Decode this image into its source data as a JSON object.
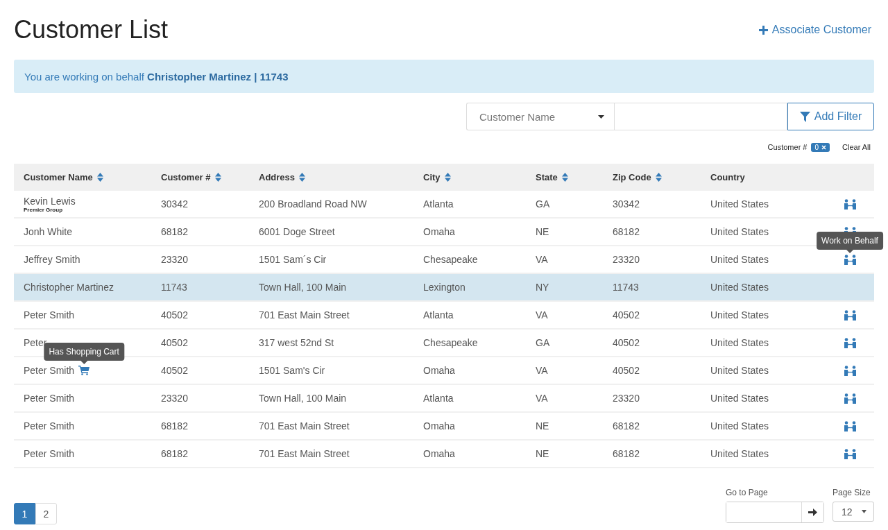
{
  "page_title": "Customer List",
  "associate_button": {
    "label": "Associate Customer"
  },
  "notice": {
    "text": "You are working on behalf **Christopher Martinez | 11743**"
  },
  "filter": {
    "field_select": "Customer Name",
    "add_button": "Add Filter"
  },
  "active_filters": [
    {
      "label": "Customer #",
      "value": "0"
    }
  ],
  "clear_all": "Clear All",
  "table": {
    "columns": [
      {
        "label": "Customer Name",
        "sortable": true
      },
      {
        "label": "Customer #",
        "sortable": true
      },
      {
        "label": "Address",
        "sortable": true
      },
      {
        "label": "City",
        "sortable": true
      },
      {
        "label": "State",
        "sortable": true
      },
      {
        "label": "Zip Code",
        "sortable": true
      },
      {
        "label": "Country",
        "sortable": false
      }
    ],
    "rows": [
      {
        "name": "Kevin Lewis",
        "company": "Premier Group",
        "number": "30342",
        "address": "200 Broadland Road NW",
        "city": "Atlanta",
        "state": "GA",
        "zip": "30342",
        "country": "United States",
        "selected": false,
        "cart": false,
        "work_on_behalf": true
      },
      {
        "name": "Jonh White",
        "number": "68182",
        "address": "6001 Doge Street",
        "city": "Omaha",
        "state": "NE",
        "zip": "68182",
        "country": "United States",
        "selected": false,
        "cart": false,
        "work_on_behalf": true
      },
      {
        "name": "Jeffrey Smith",
        "number": "23320",
        "address": "1501 Sam´s Cir",
        "city": "Chesapeake",
        "state": "VA",
        "zip": "23320",
        "country": "United States",
        "selected": false,
        "cart": false,
        "work_on_behalf": true,
        "action_tooltip": "Work on Behalf"
      },
      {
        "name": "Christopher Martinez",
        "number": "11743",
        "address": "Town Hall, 100 Main",
        "city": "Lexington",
        "state": "NY",
        "zip": "11743",
        "country": "United States",
        "selected": true,
        "cart": false,
        "work_on_behalf": false
      },
      {
        "name": "Peter Smith",
        "number": "40502",
        "address": "701 East Main Street",
        "city": "Atlanta",
        "state": "VA",
        "zip": "40502",
        "country": "United States",
        "selected": false,
        "cart": false,
        "work_on_behalf": true
      },
      {
        "name": "Peter",
        "number": "40502",
        "address": "317 west 52nd St",
        "city": "Chesapeake",
        "state": "GA",
        "zip": "40502",
        "country": "United States",
        "selected": false,
        "cart": false,
        "work_on_behalf": true
      },
      {
        "name": "Peter Smith",
        "number": "40502",
        "address": "1501 Sam's Cir",
        "city": "Omaha",
        "state": "VA",
        "zip": "40502",
        "country": "United States",
        "selected": false,
        "cart": true,
        "cart_tooltip": "Has Shopping Cart",
        "work_on_behalf": true
      },
      {
        "name": "Peter Smith",
        "number": "23320",
        "address": "Town Hall, 100 Main",
        "city": "Atlanta",
        "state": "VA",
        "zip": "23320",
        "country": "United States",
        "selected": false,
        "cart": false,
        "work_on_behalf": true
      },
      {
        "name": "Peter Smith",
        "number": "68182",
        "address": "701 East Main Street",
        "city": "Omaha",
        "state": "NE",
        "zip": "68182",
        "country": "United States",
        "selected": false,
        "cart": false,
        "work_on_behalf": true
      },
      {
        "name": "Peter Smith",
        "number": "68182",
        "address": "701 East Main Street",
        "city": "Omaha",
        "state": "NE",
        "zip": "68182",
        "country": "United States",
        "selected": false,
        "cart": false,
        "work_on_behalf": true
      }
    ]
  },
  "pagination": {
    "pages": [
      {
        "label": "1",
        "selected": true
      },
      {
        "label": "2",
        "selected": false
      }
    ]
  },
  "go_to_page": {
    "label": "Go to Page"
  },
  "page_size": {
    "label": "Page Size",
    "value": "12"
  }
}
